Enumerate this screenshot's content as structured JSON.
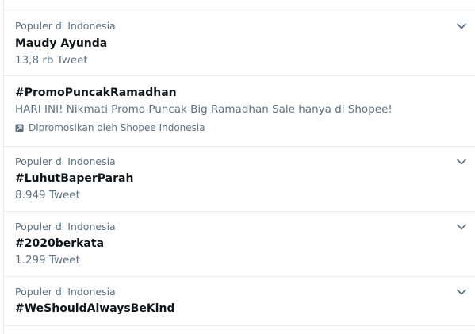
{
  "trends": [
    {
      "context": "Populer di Indonesia",
      "name": "Maudy Ayunda",
      "count": "13,8 rb Tweet"
    },
    {
      "name": "#PromoPuncakRamadhan",
      "description": "HARI INI! Nikmati Promo Puncak Big Ramadhan Sale hanya di Shopee!",
      "promoted_by": "Dipromosikan oleh Shopee Indonesia"
    },
    {
      "context": "Populer di Indonesia",
      "name": "#LuhutBaperParah",
      "count": "8.949 Tweet"
    },
    {
      "context": "Populer di Indonesia",
      "name": "#2020berkata",
      "count": "1.299 Tweet"
    },
    {
      "context": "Populer di Indonesia",
      "name": "#WeShouldAlwaysBeKind"
    }
  ],
  "icons": {
    "more": "chevron-down-icon",
    "promoted": "promoted-icon"
  },
  "colors": {
    "secondary_text": "#5b7083",
    "primary_text": "#0f1419",
    "divider": "#e6ecf0"
  }
}
